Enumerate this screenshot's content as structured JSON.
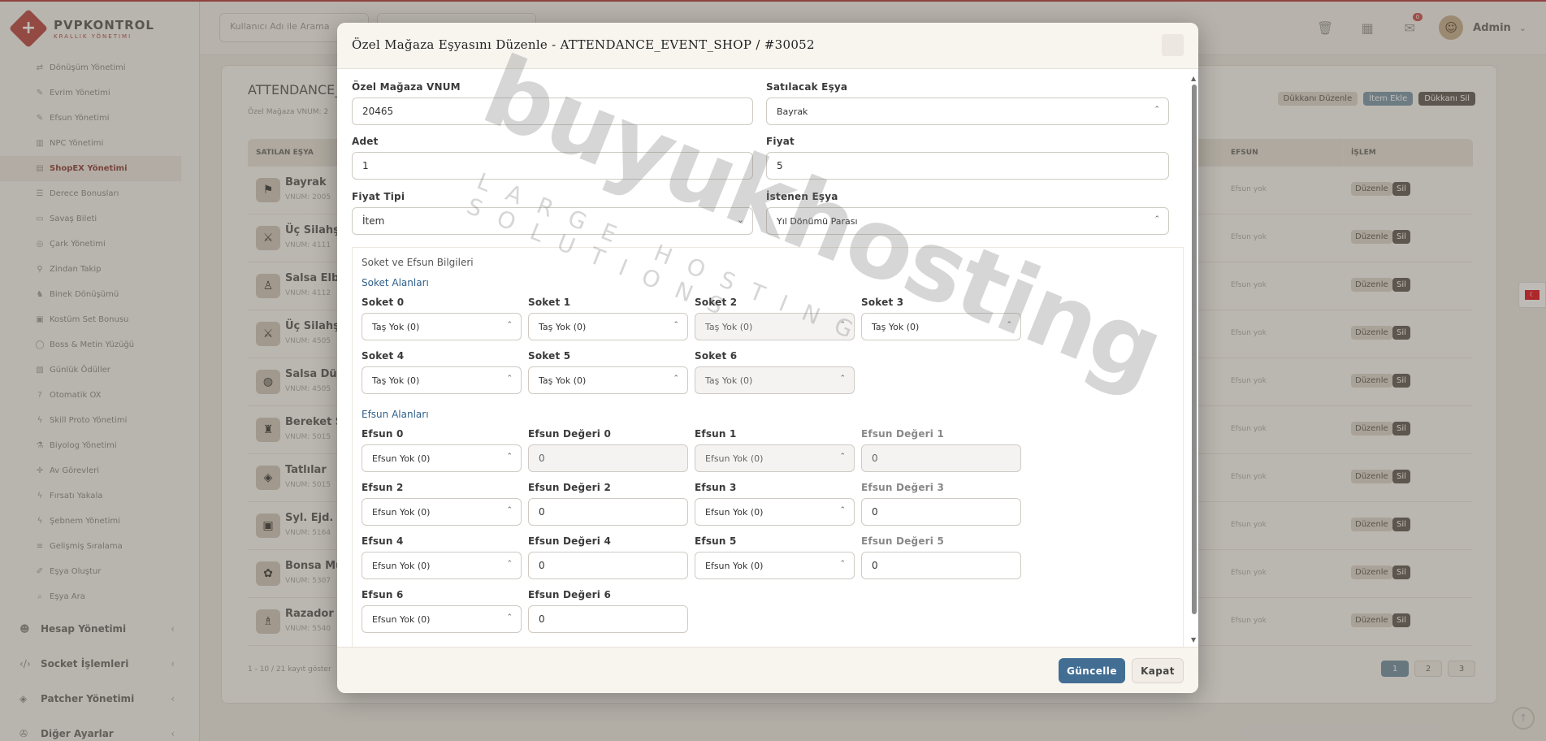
{
  "brand": {
    "title": "PVPKONTROL",
    "subtitle": "KRALLIK YÖNETIMI"
  },
  "sidebar": {
    "submenu": [
      {
        "label": "Dönüşüm Yönetimi",
        "icon": "swap-icon"
      },
      {
        "label": "Evrim Yönetimi",
        "icon": "magic-icon"
      },
      {
        "label": "Efsun Yönetimi",
        "icon": "magic-icon"
      },
      {
        "label": "NPC Yönetimi",
        "icon": "building-icon"
      },
      {
        "label": "ShopEX Yönetimi",
        "icon": "shop-icon",
        "active": true
      },
      {
        "label": "Derece Bonusları",
        "icon": "list-icon"
      },
      {
        "label": "Savaş Bileti",
        "icon": "ticket-icon"
      },
      {
        "label": "Çark Yönetimi",
        "icon": "wheel-icon"
      },
      {
        "label": "Zindan Takip",
        "icon": "pin-icon"
      },
      {
        "label": "Binek Dönüşümü",
        "icon": "horse-icon"
      },
      {
        "label": "Kostüm Set Bonusu",
        "icon": "shirt-icon"
      },
      {
        "label": "Boss & Metin Yüzüğü",
        "icon": "ring-icon"
      },
      {
        "label": "Günlük Ödüller",
        "icon": "gift-icon"
      },
      {
        "label": "Otomatik OX",
        "icon": "question-icon"
      },
      {
        "label": "Skill Proto Yönetimi",
        "icon": "bolt-icon"
      },
      {
        "label": "Biyolog Yönetimi",
        "icon": "flask-icon"
      },
      {
        "label": "Av Görevleri",
        "icon": "target-icon"
      },
      {
        "label": "Fırsatı Yakala",
        "icon": "bolt-icon"
      },
      {
        "label": "Şebnem Yönetimi",
        "icon": "bolt-icon"
      },
      {
        "label": "Gelişmiş Sıralama",
        "icon": "sort-icon"
      },
      {
        "label": "Eşya Oluştur",
        "icon": "edit-icon"
      },
      {
        "label": "Eşya Ara",
        "icon": "search-icon"
      }
    ],
    "mainmenu": [
      {
        "label": "Hesap Yönetimi",
        "icon": "users-icon"
      },
      {
        "label": "Socket İşlemleri",
        "icon": "code-icon"
      },
      {
        "label": "Patcher Yönetimi",
        "icon": "gamepad-icon"
      },
      {
        "label": "Diğer Ayarlar",
        "icon": "wrench-icon"
      }
    ]
  },
  "topbar": {
    "search_placeholder": "Kullanıcı Adı ile Arama",
    "notification_count": "0",
    "user_name": "Admin"
  },
  "card": {
    "title": "ATTENDANCE_",
    "subtitle": "Özel Mağaza VNUM: 2",
    "actions": {
      "shop_edit": "Dükkanı Düzenle",
      "add_item": "İtem Ekle",
      "shop_delete": "Dükkanı Sil"
    },
    "columns": {
      "item": "SATILAN EŞYA",
      "efsun": "EFSUN",
      "action": "İŞLEM"
    },
    "rows": [
      {
        "name": "Bayrak",
        "vnum": "VNUM: 2005",
        "efsun": "Efsun yok",
        "edit": "Düzenle",
        "del": "Sil"
      },
      {
        "name": "Üç Silahşö",
        "vnum": "VNUM: 4111",
        "efsun": "Efsun yok",
        "edit": "Düzenle",
        "del": "Sil"
      },
      {
        "name": "Salsa Elbis",
        "vnum": "VNUM: 4112",
        "efsun": "Efsun yok",
        "edit": "Düzenle",
        "del": "Sil"
      },
      {
        "name": "Üç Silahşö",
        "vnum": "VNUM: 4505",
        "efsun": "Efsun yok",
        "edit": "Düzenle",
        "del": "Sil"
      },
      {
        "name": "Salsa Düğ",
        "vnum": "VNUM: 4505",
        "efsun": "Efsun yok",
        "edit": "Düzenle",
        "del": "Sil"
      },
      {
        "name": "Bereket S",
        "vnum": "VNUM: 5015",
        "efsun": "Efsun yok",
        "edit": "Düzenle",
        "del": "Sil"
      },
      {
        "name": "Tatlılar",
        "vnum": "VNUM: 5015",
        "efsun": "Efsun yok",
        "edit": "Düzenle",
        "del": "Sil"
      },
      {
        "name": "Syl. Ejd. K",
        "vnum": "VNUM: 5164",
        "efsun": "Efsun yok",
        "edit": "Düzenle",
        "del": "Sil"
      },
      {
        "name": "Bonsa Mü",
        "vnum": "VNUM: 5307",
        "efsun": "Efsun yok",
        "edit": "Düzenle",
        "del": "Sil"
      },
      {
        "name": "Razador Y",
        "vnum": "VNUM: 5540",
        "efsun": "Efsun yok",
        "edit": "Düzenle",
        "del": "Sil"
      }
    ],
    "pager_info": "1 - 10 / 21 kayıt göster",
    "pages": [
      "1",
      "2",
      "3"
    ]
  },
  "modal": {
    "title": "Özel Mağaza Eşyasını Düzenle - ATTENDANCE_EVENT_SHOP / #30052",
    "vnum_label": "Özel Mağaza VNUM",
    "vnum_value": "20465",
    "item_label": "Satılacak Eşya",
    "item_value": "Bayrak",
    "count_label": "Adet",
    "count_value": "1",
    "price_label": "Fiyat",
    "price_value": "5",
    "price_type_label": "Fiyat Tipi",
    "price_type_value": "İtem",
    "req_item_label": "İstenen Eşya",
    "req_item_value": "Yıl Dönümü Parası",
    "section_title": "Soket ve Efsun Bilgileri",
    "socket_title": "Soket Alanları",
    "sockets": [
      {
        "label": "Soket 0",
        "value": "Taş Yok (0)"
      },
      {
        "label": "Soket 1",
        "value": "Taş Yok (0)"
      },
      {
        "label": "Soket 2",
        "value": "Taş Yok (0)"
      },
      {
        "label": "Soket 3",
        "value": "Taş Yok (0)"
      },
      {
        "label": "Soket 4",
        "value": "Taş Yok (0)"
      },
      {
        "label": "Soket 5",
        "value": "Taş Yok (0)"
      },
      {
        "label": "Soket 6",
        "value": "Taş Yok (0)"
      }
    ],
    "efsun_title": "Efsun Alanları",
    "efsuns": [
      {
        "label": "Efsun 0",
        "value": "Efsun Yok (0)",
        "val_label": "Efsun Değeri 0",
        "val": "0"
      },
      {
        "label": "Efsun 1",
        "value": "Efsun Yok (0)",
        "val_label": "Efsun Değeri 1",
        "val": "0"
      },
      {
        "label": "Efsun 2",
        "value": "Efsun Yok (0)",
        "val_label": "Efsun Değeri 2",
        "val": "0"
      },
      {
        "label": "Efsun 3",
        "value": "Efsun Yok (0)",
        "val_label": "Efsun Değeri 3",
        "val": "0"
      },
      {
        "label": "Efsun 4",
        "value": "Efsun Yok (0)",
        "val_label": "Efsun Değeri 4",
        "val": "0"
      },
      {
        "label": "Efsun 5",
        "value": "Efsun Yok (0)",
        "val_label": "Efsun Değeri 5",
        "val": "0"
      },
      {
        "label": "Efsun 6",
        "value": "Efsun Yok (0)",
        "val_label": "Efsun Değeri 6",
        "val": "0"
      }
    ],
    "update_label": "Güncelle",
    "close_label": "Kapat"
  },
  "watermark": {
    "big": "buyukhosting",
    "small": "LARGE HOSTING SOLUTIONS"
  },
  "colors": {
    "brand": "#b8433f",
    "primary": "#436e94",
    "dark": "#5e5751"
  }
}
